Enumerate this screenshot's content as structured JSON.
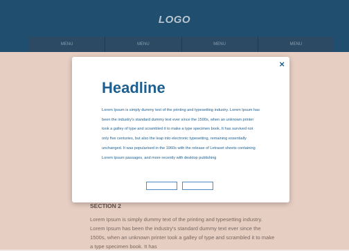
{
  "header": {
    "logo": "LOGO",
    "nav": [
      "MENU",
      "MENU",
      "MENU",
      "MENU"
    ]
  },
  "content": {
    "section_title": "SECTION 2",
    "section_body": "Lorem Ipsum is simply dummy text of the printing and typesetting industry. Lorem Ipsum has been the industry's standard dummy text ever since the 1500s, when an unknown printer took a galley of type and scrambled it to make a type specimen book. It has"
  },
  "modal": {
    "close": "×",
    "headline": "Headline",
    "body": "Lorem Ipsum is simply dummy text of the printing and typesetting industry. Lorem Ipsum has been the industry's standard dummy text ever since the 1500s, when an unknown printer took a galley of type and scrambled it to make a type specimen book. It has survived not only five centuries, but also the leap into electronic typesetting, remaining essentially unchanged. It was popularised in the 1960s with the release of Letraset sheets containing Lorem Ipsum passages, and more recently with desktop publishing",
    "button_1": "",
    "button_2": ""
  },
  "colors": {
    "header_bg": "#1f4e6e",
    "accent": "#1e5f8f",
    "overlay": "#d28c6e"
  }
}
